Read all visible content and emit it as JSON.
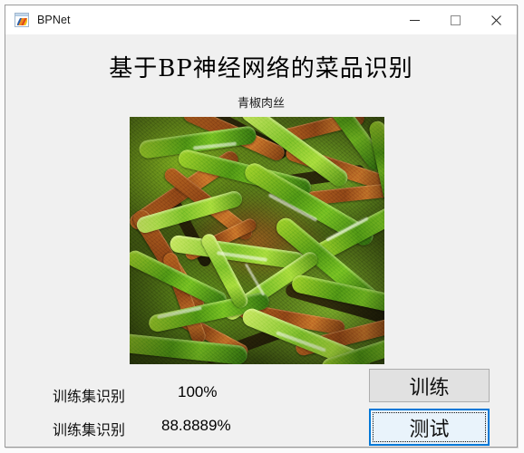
{
  "window": {
    "title": "BPNet",
    "icon": "matlab-figure-icon",
    "controls": {
      "minimize": "minimize-icon",
      "maximize": "maximize-icon",
      "close": "close-icon"
    }
  },
  "main": {
    "heading": "基于BP神经网络的菜品识别",
    "image_caption": "青椒肉丝",
    "image_alt": "青椒肉丝",
    "results": [
      {
        "label": "训练集识别",
        "value": "100%"
      },
      {
        "label": "训练集识别",
        "value": "88.8889%"
      }
    ],
    "buttons": {
      "train": "训练",
      "test": "测试"
    }
  },
  "colors": {
    "window_bg": "#f0f0f0",
    "titlebar_bg": "#ffffff",
    "border": "#9a9a9a",
    "button_face": "#e1e1e1",
    "button_border": "#adadad",
    "focus_accent": "#0078d7",
    "focus_fill": "#e9f3fb",
    "text": "#111111"
  }
}
